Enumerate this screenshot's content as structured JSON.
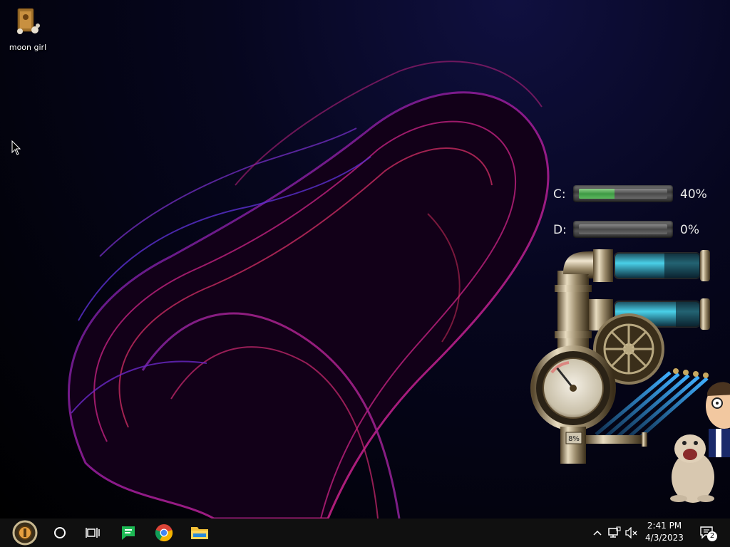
{
  "desktop": {
    "icons": [
      {
        "label": "moon girl",
        "icon": "folder-icon"
      }
    ]
  },
  "drives": [
    {
      "letter": "C:",
      "percent_label": "40%",
      "percent": 40
    },
    {
      "letter": "D:",
      "percent_label": "0%",
      "percent": 0
    }
  ],
  "gadget": {
    "gauge_readout": "8%",
    "gauge_value": 8
  },
  "taskbar": {
    "clock": {
      "time": "2:41 PM",
      "date": "4/3/2023"
    },
    "notifications_count": "2",
    "apps": [
      "start-icon",
      "cortana-icon",
      "task-view-icon",
      "chat-app-icon",
      "chrome-icon",
      "file-explorer-icon"
    ]
  },
  "colors": {
    "taskbar": "#101010",
    "meter_fill": "#4caf50",
    "chat_app": "#1db954",
    "folder": "#f2c037"
  }
}
